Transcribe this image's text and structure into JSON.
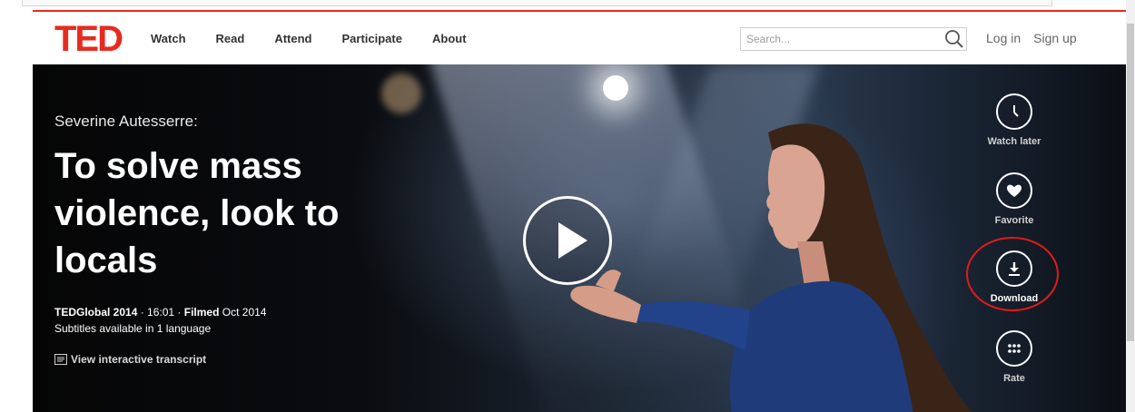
{
  "header": {
    "logo": "TED",
    "nav": [
      "Watch",
      "Read",
      "Attend",
      "Participate",
      "About"
    ],
    "search_placeholder": "Search...",
    "login": "Log in",
    "signup": "Sign up"
  },
  "talk": {
    "speaker": "Severine Autesserre:",
    "title": "To solve mass violence, look to locals",
    "event": "TEDGlobal 2014",
    "duration": "· 16:01 ·",
    "filmed_label": "Filmed",
    "filmed_date": "Oct 2014",
    "subtitles": "Subtitles available in 1 language",
    "transcript": "View interactive transcript"
  },
  "actions": {
    "watch_later": "Watch later",
    "favorite": "Favorite",
    "download": "Download",
    "rate": "Rate"
  },
  "colors": {
    "brand_red": "#e62b1e",
    "annotation_red": "#e11a1a"
  }
}
